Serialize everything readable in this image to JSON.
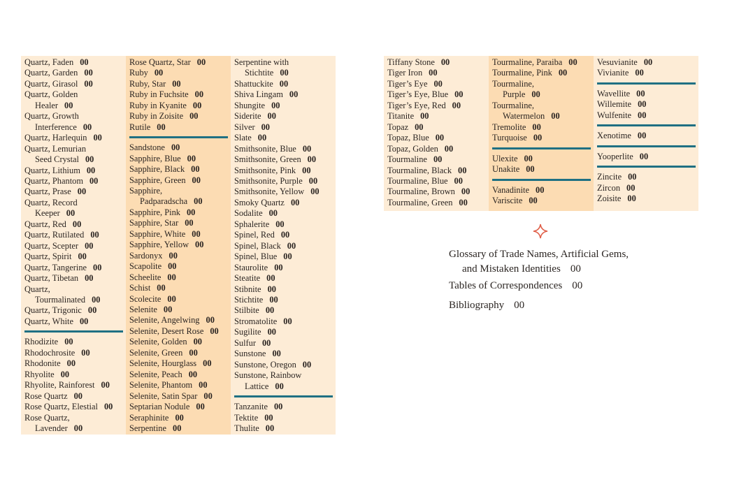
{
  "left_page": {
    "columns": [
      {
        "shade": "light",
        "groups": [
          [
            {
              "lines": [
                "Quartz, Faden"
              ],
              "page": "00"
            },
            {
              "lines": [
                "Quartz, Garden"
              ],
              "page": "00"
            },
            {
              "lines": [
                "Quartz, Girasol"
              ],
              "page": "00"
            },
            {
              "lines": [
                "Quartz, Golden",
                "Healer"
              ],
              "page": "00"
            },
            {
              "lines": [
                "Quartz, Growth",
                "Interference"
              ],
              "page": "00"
            },
            {
              "lines": [
                "Quartz, Harlequin"
              ],
              "page": "00"
            },
            {
              "lines": [
                "Quartz, Lemurian",
                "Seed Crystal"
              ],
              "page": "00"
            },
            {
              "lines": [
                "Quartz, Lithium"
              ],
              "page": "00"
            },
            {
              "lines": [
                "Quartz, Phantom"
              ],
              "page": "00"
            },
            {
              "lines": [
                "Quartz, Prase"
              ],
              "page": "00"
            },
            {
              "lines": [
                "Quartz, Record",
                "Keeper"
              ],
              "page": "00"
            },
            {
              "lines": [
                "Quartz, Red"
              ],
              "page": "00"
            },
            {
              "lines": [
                "Quartz, Rutilated"
              ],
              "page": "00"
            },
            {
              "lines": [
                "Quartz, Scepter"
              ],
              "page": "00"
            },
            {
              "lines": [
                "Quartz, Spirit"
              ],
              "page": "00"
            },
            {
              "lines": [
                "Quartz, Tangerine"
              ],
              "page": "00"
            },
            {
              "lines": [
                "Quartz, Tibetan"
              ],
              "page": "00"
            },
            {
              "lines": [
                "Quartz,",
                "Tourmalinated"
              ],
              "page": "00"
            },
            {
              "lines": [
                "Quartz, Trigonic"
              ],
              "page": "00"
            },
            {
              "lines": [
                "Quartz, White"
              ],
              "page": "00"
            }
          ],
          [
            {
              "lines": [
                "Rhodizite"
              ],
              "page": "00"
            },
            {
              "lines": [
                "Rhodochrosite"
              ],
              "page": "00"
            },
            {
              "lines": [
                "Rhodonite"
              ],
              "page": "00"
            },
            {
              "lines": [
                "Rhyolite"
              ],
              "page": "00"
            },
            {
              "lines": [
                "Rhyolite, Rainforest"
              ],
              "page": "00"
            },
            {
              "lines": [
                "Rose Quartz"
              ],
              "page": "00"
            },
            {
              "lines": [
                "Rose Quartz, Elestial"
              ],
              "page": "00"
            },
            {
              "lines": [
                "Rose Quartz,",
                "Lavender"
              ],
              "page": "00"
            }
          ]
        ]
      },
      {
        "shade": "dark",
        "groups": [
          [
            {
              "lines": [
                "Rose Quartz, Star"
              ],
              "page": "00"
            },
            {
              "lines": [
                "Ruby"
              ],
              "page": "00"
            },
            {
              "lines": [
                "Ruby, Star"
              ],
              "page": "00"
            },
            {
              "lines": [
                "Ruby in Fuchsite"
              ],
              "page": "00"
            },
            {
              "lines": [
                "Ruby in Kyanite"
              ],
              "page": "00"
            },
            {
              "lines": [
                "Ruby in Zoisite"
              ],
              "page": "00"
            },
            {
              "lines": [
                "Rutile"
              ],
              "page": "00"
            }
          ],
          [
            {
              "lines": [
                "Sandstone"
              ],
              "page": "00"
            },
            {
              "lines": [
                "Sapphire, Blue"
              ],
              "page": "00"
            },
            {
              "lines": [
                "Sapphire, Black"
              ],
              "page": "00"
            },
            {
              "lines": [
                "Sapphire, Green"
              ],
              "page": "00"
            },
            {
              "lines": [
                "Sapphire,",
                "Padparadscha"
              ],
              "page": "00"
            },
            {
              "lines": [
                "Sapphire, Pink"
              ],
              "page": "00"
            },
            {
              "lines": [
                "Sapphire, Star"
              ],
              "page": "00"
            },
            {
              "lines": [
                "Sapphire, White"
              ],
              "page": "00"
            },
            {
              "lines": [
                "Sapphire, Yellow"
              ],
              "page": "00"
            },
            {
              "lines": [
                "Sardonyx"
              ],
              "page": "00"
            },
            {
              "lines": [
                "Scapolite"
              ],
              "page": "00"
            },
            {
              "lines": [
                "Scheelite"
              ],
              "page": "00"
            },
            {
              "lines": [
                "Schist"
              ],
              "page": "00"
            },
            {
              "lines": [
                "Scolecite"
              ],
              "page": "00"
            },
            {
              "lines": [
                "Selenite"
              ],
              "page": "00"
            },
            {
              "lines": [
                "Selenite, Angelwing"
              ],
              "page": "00"
            },
            {
              "lines": [
                "Selenite, Desert Rose"
              ],
              "page": "00"
            },
            {
              "lines": [
                "Selenite, Golden"
              ],
              "page": "00"
            },
            {
              "lines": [
                "Selenite, Green"
              ],
              "page": "00"
            },
            {
              "lines": [
                "Selenite, Hourglass"
              ],
              "page": "00"
            },
            {
              "lines": [
                "Selenite, Peach"
              ],
              "page": "00"
            },
            {
              "lines": [
                "Selenite, Phantom"
              ],
              "page": "00"
            },
            {
              "lines": [
                "Selenite, Satin Spar"
              ],
              "page": "00"
            },
            {
              "lines": [
                "Septarian Nodule"
              ],
              "page": "00"
            },
            {
              "lines": [
                "Seraphinite"
              ],
              "page": "00"
            },
            {
              "lines": [
                "Serpentine"
              ],
              "page": "00"
            }
          ]
        ]
      },
      {
        "shade": "light",
        "groups": [
          [
            {
              "lines": [
                "Serpentine with",
                "Stichtite"
              ],
              "page": "00"
            },
            {
              "lines": [
                "Shattuckite"
              ],
              "page": "00"
            },
            {
              "lines": [
                "Shiva Lingam"
              ],
              "page": "00"
            },
            {
              "lines": [
                "Shungite"
              ],
              "page": "00"
            },
            {
              "lines": [
                "Siderite"
              ],
              "page": "00"
            },
            {
              "lines": [
                "Silver"
              ],
              "page": "00"
            },
            {
              "lines": [
                "Slate"
              ],
              "page": "00"
            },
            {
              "lines": [
                "Smithsonite, Blue"
              ],
              "page": "00"
            },
            {
              "lines": [
                "Smithsonite, Green"
              ],
              "page": "00"
            },
            {
              "lines": [
                "Smithsonite, Pink"
              ],
              "page": "00"
            },
            {
              "lines": [
                "Smithsonite, Purple"
              ],
              "page": "00"
            },
            {
              "lines": [
                "Smithsonite, Yellow"
              ],
              "page": "00"
            },
            {
              "lines": [
                "Smoky Quartz"
              ],
              "page": "00"
            },
            {
              "lines": [
                "Sodalite"
              ],
              "page": "00"
            },
            {
              "lines": [
                "Sphalerite"
              ],
              "page": "00"
            },
            {
              "lines": [
                "Spinel, Red"
              ],
              "page": "00"
            },
            {
              "lines": [
                "Spinel, Black"
              ],
              "page": "00"
            },
            {
              "lines": [
                "Spinel, Blue"
              ],
              "page": "00"
            },
            {
              "lines": [
                "Staurolite"
              ],
              "page": "00"
            },
            {
              "lines": [
                "Steatite"
              ],
              "page": "00"
            },
            {
              "lines": [
                "Stibnite"
              ],
              "page": "00"
            },
            {
              "lines": [
                "Stichtite"
              ],
              "page": "00"
            },
            {
              "lines": [
                "Stilbite"
              ],
              "page": "00"
            },
            {
              "lines": [
                "Stromatolite"
              ],
              "page": "00"
            },
            {
              "lines": [
                "Sugilite"
              ],
              "page": "00"
            },
            {
              "lines": [
                "Sulfur"
              ],
              "page": "00"
            },
            {
              "lines": [
                "Sunstone"
              ],
              "page": "00"
            },
            {
              "lines": [
                "Sunstone, Oregon"
              ],
              "page": "00"
            },
            {
              "lines": [
                "Sunstone, Rainbow",
                "Lattice"
              ],
              "page": "00"
            }
          ],
          [
            {
              "lines": [
                "Tanzanite"
              ],
              "page": "00"
            },
            {
              "lines": [
                "Tektite"
              ],
              "page": "00"
            },
            {
              "lines": [
                "Thulite"
              ],
              "page": "00"
            }
          ]
        ]
      }
    ]
  },
  "right_page": {
    "columns": [
      {
        "shade": "light",
        "groups": [
          [
            {
              "lines": [
                "Tiffany Stone"
              ],
              "page": "00"
            },
            {
              "lines": [
                "Tiger Iron"
              ],
              "page": "00"
            },
            {
              "lines": [
                "Tiger’s Eye"
              ],
              "page": "00"
            },
            {
              "lines": [
                "Tiger’s Eye, Blue"
              ],
              "page": "00"
            },
            {
              "lines": [
                "Tiger’s Eye, Red"
              ],
              "page": "00"
            },
            {
              "lines": [
                "Titanite"
              ],
              "page": "00"
            },
            {
              "lines": [
                "Topaz"
              ],
              "page": "00"
            },
            {
              "lines": [
                "Topaz, Blue"
              ],
              "page": "00"
            },
            {
              "lines": [
                "Topaz, Golden"
              ],
              "page": "00"
            },
            {
              "lines": [
                "Tourmaline"
              ],
              "page": "00"
            },
            {
              "lines": [
                "Tourmaline, Black"
              ],
              "page": "00"
            },
            {
              "lines": [
                "Tourmaline, Blue"
              ],
              "page": "00"
            },
            {
              "lines": [
                "Tourmaline, Brown"
              ],
              "page": "00"
            },
            {
              "lines": [
                "Tourmaline, Green"
              ],
              "page": "00"
            }
          ]
        ]
      },
      {
        "shade": "dark",
        "groups": [
          [
            {
              "lines": [
                "Tourmaline, Paraiba"
              ],
              "page": "00"
            },
            {
              "lines": [
                "Tourmaline, Pink"
              ],
              "page": "00"
            },
            {
              "lines": [
                "Tourmaline,",
                "Purple"
              ],
              "page": "00"
            },
            {
              "lines": [
                "Tourmaline,",
                "Watermelon"
              ],
              "page": "00"
            },
            {
              "lines": [
                "Tremolite"
              ],
              "page": "00"
            },
            {
              "lines": [
                "Turquoise"
              ],
              "page": "00"
            }
          ],
          [
            {
              "lines": [
                "Ulexite"
              ],
              "page": "00"
            },
            {
              "lines": [
                "Unakite"
              ],
              "page": "00"
            }
          ],
          [
            {
              "lines": [
                "Vanadinite"
              ],
              "page": "00"
            },
            {
              "lines": [
                "Variscite"
              ],
              "page": "00"
            }
          ]
        ]
      },
      {
        "shade": "light",
        "groups": [
          [
            {
              "lines": [
                "Vesuvianite"
              ],
              "page": "00"
            },
            {
              "lines": [
                "Vivianite"
              ],
              "page": "00"
            }
          ],
          [
            {
              "lines": [
                "Wavellite"
              ],
              "page": "00"
            },
            {
              "lines": [
                "Willemite"
              ],
              "page": "00"
            },
            {
              "lines": [
                "Wulfenite"
              ],
              "page": "00"
            }
          ],
          [
            {
              "lines": [
                "Xenotime"
              ],
              "page": "00"
            }
          ],
          [
            {
              "lines": [
                "Yooperlite"
              ],
              "page": "00"
            }
          ],
          [
            {
              "lines": [
                "Zincite"
              ],
              "page": "00"
            },
            {
              "lines": [
                "Zircon"
              ],
              "page": "00"
            },
            {
              "lines": [
                "Zoisite"
              ],
              "page": "00"
            }
          ]
        ]
      }
    ]
  },
  "ornament": {
    "icon": "four-point-star-icon",
    "color": "#e0604a"
  },
  "back_matter": [
    {
      "lines": [
        "Glossary of Trade Names, Artificial Gems,",
        "and Mistaken Identities"
      ],
      "page": "00"
    },
    {
      "lines": [
        "Tables of Correspondences"
      ],
      "page": "00"
    },
    {
      "lines": [
        "Bibliography"
      ],
      "page": "00"
    }
  ],
  "colors": {
    "light_panel": "#fdecd6",
    "dark_panel": "#fcdcb3",
    "rule": "#1f7083",
    "text": "#2b2522"
  }
}
